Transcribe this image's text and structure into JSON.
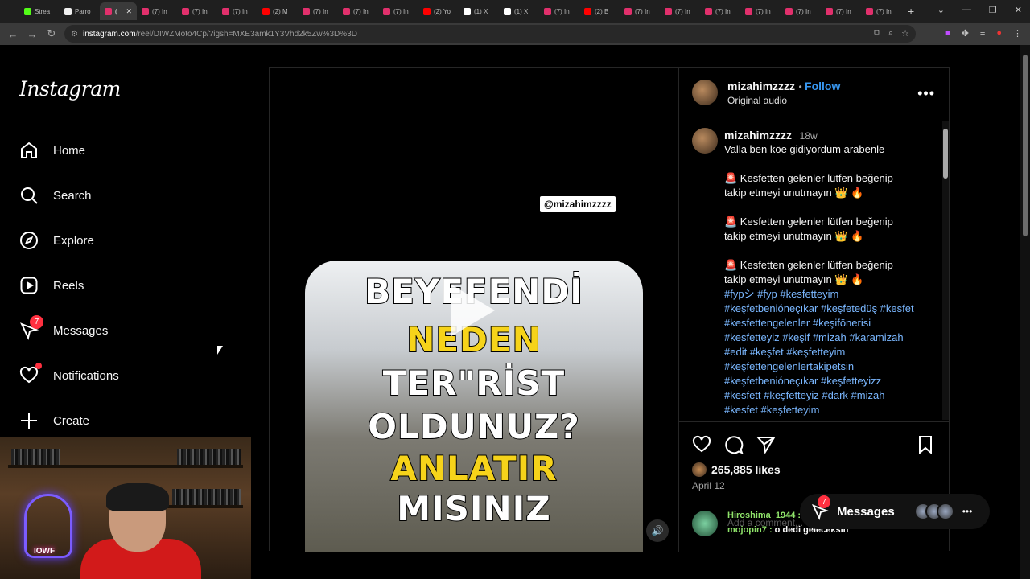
{
  "browser": {
    "tabs": [
      {
        "label": "Strea",
        "color": "#53fc18"
      },
      {
        "label": "Parro",
        "color": "#f0f0f0"
      },
      {
        "label": "(",
        "color": "#e1306c",
        "active": true
      },
      {
        "label": "(7) In",
        "color": "#e1306c"
      },
      {
        "label": "(7) In",
        "color": "#e1306c"
      },
      {
        "label": "(7) In",
        "color": "#e1306c"
      },
      {
        "label": "(2) M",
        "color": "#ff0000"
      },
      {
        "label": "(7) In",
        "color": "#e1306c"
      },
      {
        "label": "(7) In",
        "color": "#e1306c"
      },
      {
        "label": "(7) In",
        "color": "#e1306c"
      },
      {
        "label": "(2) Yo",
        "color": "#ff0000"
      },
      {
        "label": "(1) X",
        "color": "#ffffff"
      },
      {
        "label": "(1) X",
        "color": "#ffffff"
      },
      {
        "label": "(7) In",
        "color": "#e1306c"
      },
      {
        "label": "(2) B",
        "color": "#ff0000"
      },
      {
        "label": "(7) In",
        "color": "#e1306c"
      },
      {
        "label": "(7) In",
        "color": "#e1306c"
      },
      {
        "label": "(7) In",
        "color": "#e1306c"
      },
      {
        "label": "(7) In",
        "color": "#e1306c"
      },
      {
        "label": "(7) In",
        "color": "#e1306c"
      },
      {
        "label": "(7) In",
        "color": "#e1306c"
      },
      {
        "label": "(7) In",
        "color": "#e1306c"
      }
    ],
    "url_host": "instagram.com",
    "url_rest": "/reel/DIWZMoto4Cp/?igsh=MXE3amk1Y3Vhd2k5Zw%3D%3D"
  },
  "sidebar": {
    "logo": "Instagram",
    "items": [
      {
        "label": "Home",
        "icon": "home-icon"
      },
      {
        "label": "Search",
        "icon": "search-icon"
      },
      {
        "label": "Explore",
        "icon": "compass-icon"
      },
      {
        "label": "Reels",
        "icon": "reels-icon"
      },
      {
        "label": "Messages",
        "icon": "messenger-icon",
        "badge": "7"
      },
      {
        "label": "Notifications",
        "icon": "heart-icon"
      },
      {
        "label": "Create",
        "icon": "plus-icon"
      }
    ]
  },
  "webcam": {
    "neon_text": "IOWF"
  },
  "video": {
    "handle_chip": "@mizahimzzzz",
    "frame_lines": [
      "BEYEFENDİ",
      "NEDEN",
      "TER\"RİST",
      "OLDUNUZ?",
      "ANLATIR",
      "MISINIZ"
    ]
  },
  "post": {
    "username": "mizahimzzzz",
    "follow_label": "Follow",
    "audio": "Original audio",
    "caption_user": "mizahimzzzz",
    "caption_age": "18w",
    "caption_first": "Valla ben köe gidiyordum arabenle",
    "repeat_line_1": "🚨 Kesfetten gelenler lütfen beğenip",
    "repeat_line_2": "takip etmeyi unutmayın 👑 🔥",
    "hashtags": [
      "#fypシ #fyp #kesfetteyim",
      "#keşfetbenióneçıkar #keşfetedüş #kesfet",
      "#kesfettengelenler #keşifönerisi",
      "#kesfetteyiz #keşif #mizah #karamizah",
      "#edit #keşfet #keşfetteyim",
      "#keşfettengelenlertakipetsin",
      "#keşfetbenióneçıkar #keşfetteyizz",
      "#kesfett #keşfetteyiz #dark #mizah",
      "#kesfet #keşfetteyim"
    ],
    "likes": "265,885 likes",
    "date": "April 12",
    "comment_placeholder": "Add a comment..."
  },
  "chat_overlay": [
    {
      "user": "Hiroshima_1944 :",
      "text": ""
    },
    {
      "user": "mojopin7 :",
      "text": "o dedi geleceksin"
    }
  ],
  "messages_pill": {
    "label": "Messages",
    "badge": "7"
  }
}
